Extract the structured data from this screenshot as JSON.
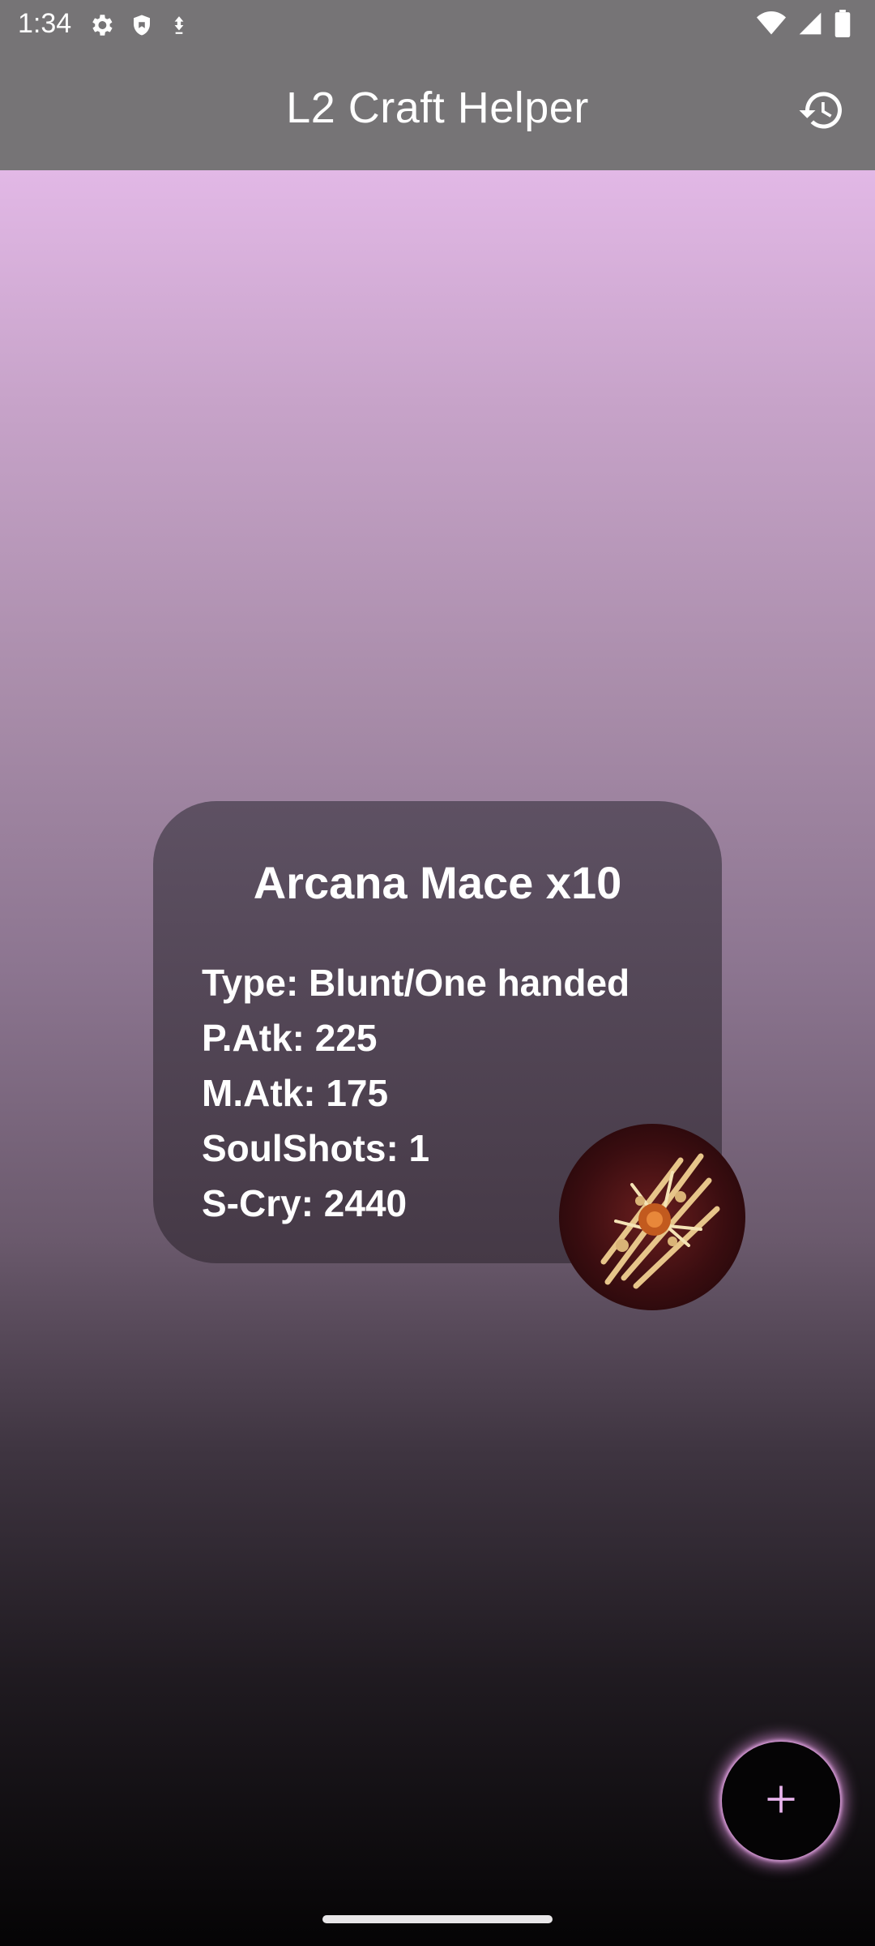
{
  "status_bar": {
    "time": "1:34",
    "icons": [
      "settings-icon",
      "shield-icon",
      "data-saver-icon",
      "wifi-icon",
      "cell-signal-icon",
      "battery-icon"
    ]
  },
  "app_bar": {
    "title": "L2 Craft Helper",
    "history_icon": "history-icon"
  },
  "item": {
    "title": "Arcana Mace x10",
    "stats": [
      "Type: Blunt/One handed",
      "P.Atk: 225",
      "M.Atk: 175",
      "SoulShots: 1",
      "S-Cry: 2440"
    ],
    "image_icon": "arcana-mace-icon"
  },
  "fab": {
    "icon": "plus-icon"
  },
  "colors": {
    "bar": "#767476",
    "accent_glow": "#e296e2",
    "card": "#4f4352"
  }
}
